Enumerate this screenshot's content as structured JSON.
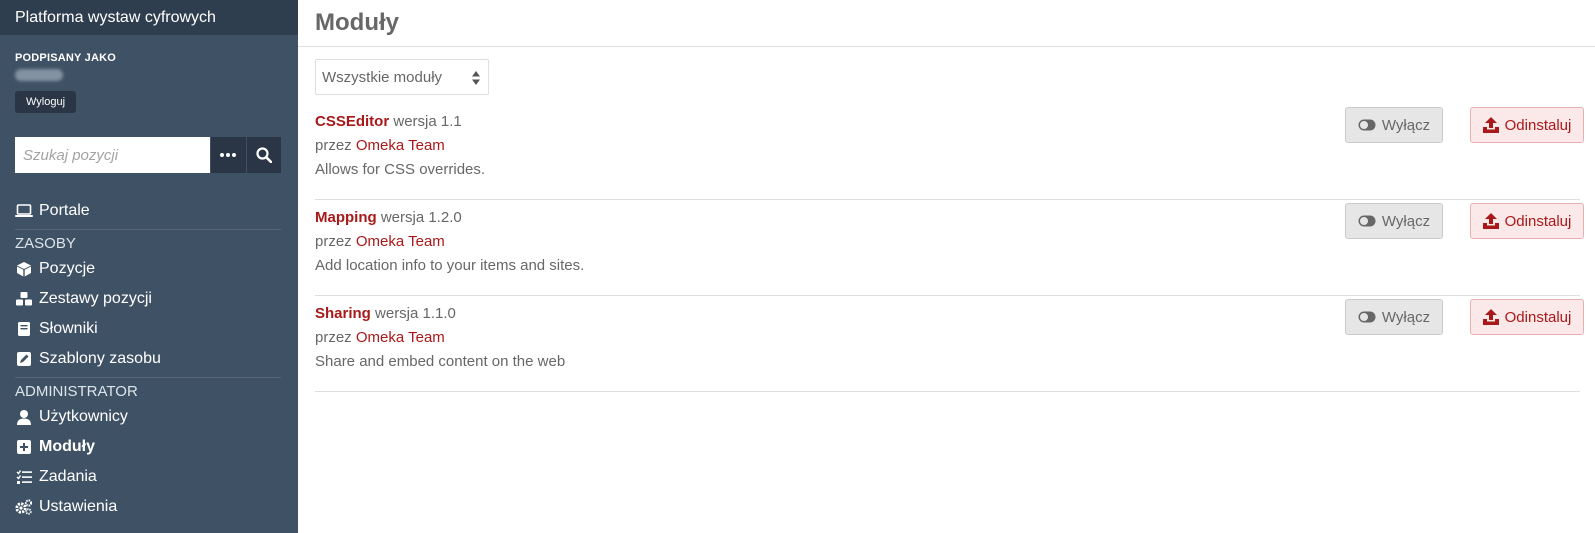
{
  "site": {
    "title": "Platforma wystaw cyfrowych"
  },
  "user": {
    "signed_in_label": "PODPISANY JAKO",
    "logout_label": "Wyloguj"
  },
  "search": {
    "placeholder": "Szukaj pozycji"
  },
  "nav": {
    "portals": "Portale",
    "resources_heading": "ZASOBY",
    "resources": [
      "Pozycje",
      "Zestawy pozycji",
      "Słowniki",
      "Szablony zasobu"
    ],
    "admin_heading": "ADMINISTRATOR",
    "admin": [
      "Użytkownicy",
      "Moduły",
      "Zadania",
      "Ustawienia"
    ]
  },
  "page": {
    "title": "Moduły"
  },
  "filter": {
    "selected": "Wszystkie moduły"
  },
  "modules": [
    {
      "name": "CSSEditor",
      "version_label": "wersja 1.1",
      "by_label": "przez",
      "author": "Omeka Team",
      "description": "Allows for CSS overrides.",
      "disable_label": "Wyłącz",
      "uninstall_label": "Odinstaluj"
    },
    {
      "name": "Mapping",
      "version_label": "wersja 1.2.0",
      "by_label": "przez",
      "author": "Omeka Team",
      "description": "Add location info to your items and sites.",
      "disable_label": "Wyłącz",
      "uninstall_label": "Odinstaluj"
    },
    {
      "name": "Sharing",
      "version_label": "wersja 1.1.0",
      "by_label": "przez",
      "author": "Omeka Team",
      "description": "Share and embed content on the web",
      "disable_label": "Wyłącz",
      "uninstall_label": "Odinstaluj"
    }
  ],
  "colors": {
    "sidebar": "#3f5165",
    "title_bar": "#2f3e4e",
    "accent": "#a91919"
  }
}
